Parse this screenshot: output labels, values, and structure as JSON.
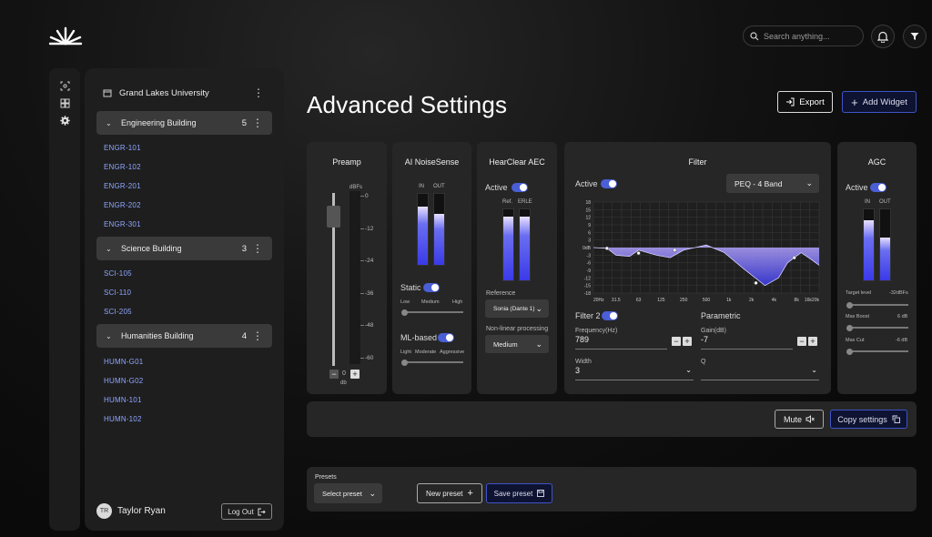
{
  "header": {
    "search_placeholder": "Search anything...",
    "icons": [
      "bell-icon",
      "filter-icon"
    ]
  },
  "rail": {
    "icons": [
      "scan-icon",
      "dashboard-icon",
      "settings-icon"
    ]
  },
  "sidebar": {
    "org": "Grand Lakes University",
    "groups": [
      {
        "name": "Engineering Building",
        "count": "5",
        "rooms": [
          "ENGR-101",
          "ENGR-102",
          "ENGR-201",
          "ENGR-202",
          "ENGR-301"
        ]
      },
      {
        "name": "Science Building",
        "count": "3",
        "rooms": [
          "SCI-105",
          "SCI-110",
          "SCI-205"
        ]
      },
      {
        "name": "Humanities Building",
        "count": "4",
        "rooms": [
          "HUMN-G01",
          "HUMN-G02",
          "HUMN-101",
          "HUMN-102"
        ]
      }
    ],
    "user": {
      "initials": "TR",
      "name": "Taylor Ryan"
    },
    "logout": "Log Out"
  },
  "page": {
    "title": "Advanced Settings",
    "export": "Export",
    "add_widget": "Add Widget"
  },
  "preamp": {
    "title": "Preamp",
    "unit_top": "dBFs",
    "ticks": [
      "0",
      "-12",
      "-24",
      "-36",
      "-48",
      "-60"
    ],
    "value": "0",
    "unit_bottom": "db",
    "level_fraction": 0.92
  },
  "noise": {
    "title": "AI NoiseSense",
    "in": "IN",
    "out": "OUT",
    "in_level": 0.82,
    "out_level": 0.72,
    "static_label": "Static",
    "static_opts": [
      "Low",
      "Medium",
      "High"
    ],
    "ml_label": "ML-based",
    "ml_opts": [
      "Light",
      "Moderate",
      "Aggressive"
    ]
  },
  "aec": {
    "title": "HearClear AEC",
    "active": "Active",
    "ref": "Ref.",
    "erle": "ERLE",
    "ref_level": 0.9,
    "erle_level": 0.9,
    "reference_label": "Reference",
    "reference_value": "Sonia (Dante 1)",
    "nlp_label": "Non-linear processing",
    "nlp_value": "Medium"
  },
  "filter": {
    "title": "Filter",
    "active": "Active",
    "mode": "PEQ - 4 Band",
    "y_ticks": [
      "18",
      "15",
      "12",
      "9",
      "6",
      "3",
      "0dB",
      "-3",
      "-6",
      "-9",
      "-12",
      "-15",
      "-18"
    ],
    "x_ticks": [
      "20Hz",
      "31.5",
      "63",
      "125",
      "250",
      "500",
      "1k",
      "2k",
      "4k",
      "8k",
      "16k20k"
    ],
    "filter2": "Filter 2",
    "parametric": "Parametric",
    "freq_label": "Frequency(Hz)",
    "freq_value": "789",
    "gain_label": "Gain(dB)",
    "gain_value": "-7",
    "width_label": "Width",
    "width_value": "3",
    "q_label": "Q",
    "q_value": ""
  },
  "agc": {
    "title": "AGC",
    "active": "Active",
    "in": "IN",
    "out": "OUT",
    "in_level": 0.85,
    "out_level": 0.6,
    "rows": [
      {
        "label": "Target level",
        "value": "-32dBFs"
      },
      {
        "label": "Max Boost",
        "value": "6 dB"
      },
      {
        "label": "Max Cut",
        "value": "-6 dB"
      }
    ]
  },
  "actions": {
    "mute": "Mute",
    "copy": "Copy settings"
  },
  "presets": {
    "label": "Presets",
    "select": "Select preset",
    "new": "New preset",
    "save": "Save preset"
  },
  "colors": {
    "accent": "#4a5fd6",
    "link": "#8ea6ff"
  }
}
